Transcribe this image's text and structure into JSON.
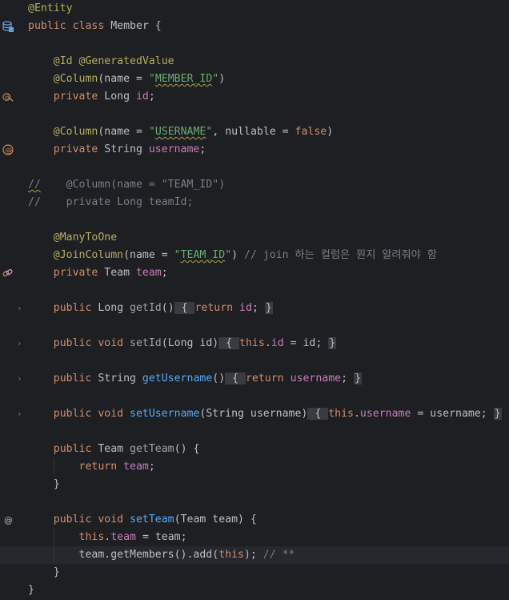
{
  "editor": {
    "language": "Java",
    "colors": {
      "background": "#1e1f22",
      "keyword": "#cf8e6d",
      "annotation": "#b3ae60",
      "string": "#6aab73",
      "field": "#c77dbb",
      "method": "#56a8f5",
      "comment": "#7a7e85",
      "text": "#bcbec4"
    },
    "lines": [
      {
        "tokens": [
          {
            "t": "@Entity",
            "c": "ann"
          }
        ]
      },
      {
        "icon": "database-icon",
        "tokens": [
          {
            "t": "public class ",
            "c": "kw"
          },
          {
            "t": "Member {",
            "c": "plain"
          }
        ]
      },
      {
        "tokens": []
      },
      {
        "tokens": [
          {
            "t": "    @Id @GeneratedValue",
            "c": "ann"
          }
        ]
      },
      {
        "tokens": [
          {
            "t": "    @Column",
            "c": "ann"
          },
          {
            "t": "(name = ",
            "c": "plain"
          },
          {
            "t": "\"",
            "c": "str"
          },
          {
            "t": "MEMBER_ID",
            "c": "str squig"
          },
          {
            "t": "\"",
            "c": "str"
          },
          {
            "t": ")",
            "c": "plain"
          }
        ]
      },
      {
        "icon": "column-link-icon",
        "tokens": [
          {
            "t": "    private ",
            "c": "kw"
          },
          {
            "t": "Long ",
            "c": "plain"
          },
          {
            "t": "id",
            "c": "fld"
          },
          {
            "t": ";",
            "c": "plain"
          }
        ]
      },
      {
        "tokens": []
      },
      {
        "tokens": [
          {
            "t": "    @Column",
            "c": "ann"
          },
          {
            "t": "(name = ",
            "c": "plain"
          },
          {
            "t": "\"",
            "c": "str"
          },
          {
            "t": "USERNAME",
            "c": "str squig"
          },
          {
            "t": "\"",
            "c": "str"
          },
          {
            "t": ", nullable = ",
            "c": "plain"
          },
          {
            "t": "false",
            "c": "kw"
          },
          {
            "t": ")",
            "c": "plain"
          }
        ]
      },
      {
        "icon": "at-column-icon",
        "tokens": [
          {
            "t": "    private ",
            "c": "kw"
          },
          {
            "t": "String ",
            "c": "plain"
          },
          {
            "t": "username",
            "c": "fld"
          },
          {
            "t": ";",
            "c": "plain"
          }
        ]
      },
      {
        "tokens": []
      },
      {
        "tokens": [
          {
            "t": "//",
            "c": "cm squig"
          },
          {
            "t": "    @Column(name = \"TEAM_ID\")",
            "c": "cm"
          }
        ]
      },
      {
        "tokens": [
          {
            "t": "//    private Long teamId;",
            "c": "cm"
          }
        ]
      },
      {
        "tokens": []
      },
      {
        "tokens": [
          {
            "t": "    @ManyToOne",
            "c": "ann"
          }
        ]
      },
      {
        "tokens": [
          {
            "t": "    @JoinColumn",
            "c": "ann"
          },
          {
            "t": "(name = ",
            "c": "plain"
          },
          {
            "t": "\"",
            "c": "str"
          },
          {
            "t": "TEAM_ID",
            "c": "str squig"
          },
          {
            "t": "\"",
            "c": "str"
          },
          {
            "t": ") ",
            "c": "plain"
          },
          {
            "t": "// join 하는 컬럼은 뭔지 알려줘야 함",
            "c": "cm"
          }
        ]
      },
      {
        "icon": "relation-link-icon",
        "tokens": [
          {
            "t": "    private ",
            "c": "kw"
          },
          {
            "t": "Team ",
            "c": "plain"
          },
          {
            "t": "team",
            "c": "fld"
          },
          {
            "t": ";",
            "c": "plain"
          }
        ]
      },
      {
        "tokens": []
      },
      {
        "fold": true,
        "tokens": [
          {
            "t": "    public ",
            "c": "kw"
          },
          {
            "t": "Long ",
            "c": "plain"
          },
          {
            "t": "getId",
            "c": "gray-fn"
          },
          {
            "t": "()",
            "c": "plain"
          },
          {
            "t": " { ",
            "c": "fold-box"
          },
          {
            "t": "return ",
            "c": "kw"
          },
          {
            "t": "id",
            "c": "fld"
          },
          {
            "t": "; ",
            "c": "plain"
          },
          {
            "t": "}",
            "c": "fold-box"
          }
        ]
      },
      {
        "tokens": []
      },
      {
        "fold": true,
        "tokens": [
          {
            "t": "    public void ",
            "c": "kw"
          },
          {
            "t": "setId",
            "c": "gray-fn"
          },
          {
            "t": "(Long id)",
            "c": "plain"
          },
          {
            "t": " { ",
            "c": "fold-box"
          },
          {
            "t": "this",
            "c": "kw"
          },
          {
            "t": ".",
            "c": "plain"
          },
          {
            "t": "id",
            "c": "fld"
          },
          {
            "t": " = id; ",
            "c": "plain"
          },
          {
            "t": "}",
            "c": "fold-box"
          }
        ]
      },
      {
        "tokens": []
      },
      {
        "fold": true,
        "tokens": [
          {
            "t": "    public ",
            "c": "kw"
          },
          {
            "t": "String ",
            "c": "plain"
          },
          {
            "t": "getUsername",
            "c": "fn"
          },
          {
            "t": "()",
            "c": "plain"
          },
          {
            "t": " { ",
            "c": "fold-box"
          },
          {
            "t": "return ",
            "c": "kw"
          },
          {
            "t": "username",
            "c": "fld"
          },
          {
            "t": "; ",
            "c": "plain"
          },
          {
            "t": "}",
            "c": "fold-box"
          }
        ]
      },
      {
        "tokens": []
      },
      {
        "fold": true,
        "tokens": [
          {
            "t": "    public void ",
            "c": "kw"
          },
          {
            "t": "setUsername",
            "c": "fn"
          },
          {
            "t": "(String username)",
            "c": "plain"
          },
          {
            "t": " { ",
            "c": "fold-box"
          },
          {
            "t": "this",
            "c": "kw"
          },
          {
            "t": ".",
            "c": "plain"
          },
          {
            "t": "username",
            "c": "fld"
          },
          {
            "t": " = username; ",
            "c": "plain"
          },
          {
            "t": "}",
            "c": "fold-box"
          }
        ]
      },
      {
        "tokens": []
      },
      {
        "tokens": [
          {
            "t": "    public ",
            "c": "kw"
          },
          {
            "t": "Team ",
            "c": "plain"
          },
          {
            "t": "getTeam",
            "c": "gray-fn"
          },
          {
            "t": "() {",
            "c": "plain"
          }
        ]
      },
      {
        "tokens": [
          {
            "t": "        return ",
            "c": "kw"
          },
          {
            "t": "team",
            "c": "fld"
          },
          {
            "t": ";",
            "c": "plain"
          }
        ]
      },
      {
        "tokens": [
          {
            "t": "    }",
            "c": "plain"
          }
        ]
      },
      {
        "tokens": []
      },
      {
        "icon": "at-icon",
        "tokens": [
          {
            "t": "    public void ",
            "c": "kw"
          },
          {
            "t": "setTeam",
            "c": "fn"
          },
          {
            "t": "(Team team) {",
            "c": "plain"
          }
        ]
      },
      {
        "tokens": [
          {
            "t": "        this",
            "c": "kw"
          },
          {
            "t": ".",
            "c": "plain"
          },
          {
            "t": "team",
            "c": "fld"
          },
          {
            "t": " = team;",
            "c": "plain"
          }
        ]
      },
      {
        "current": true,
        "tokens": [
          {
            "t": "        team.getMembers().add(",
            "c": "plain"
          },
          {
            "t": "this",
            "c": "kw"
          },
          {
            "t": "); ",
            "c": "plain"
          },
          {
            "t": "// **",
            "c": "cm"
          }
        ]
      },
      {
        "tokens": [
          {
            "t": "    }",
            "c": "plain"
          }
        ]
      },
      {
        "tokens": [
          {
            "t": "}",
            "c": "plain"
          }
        ]
      }
    ]
  }
}
